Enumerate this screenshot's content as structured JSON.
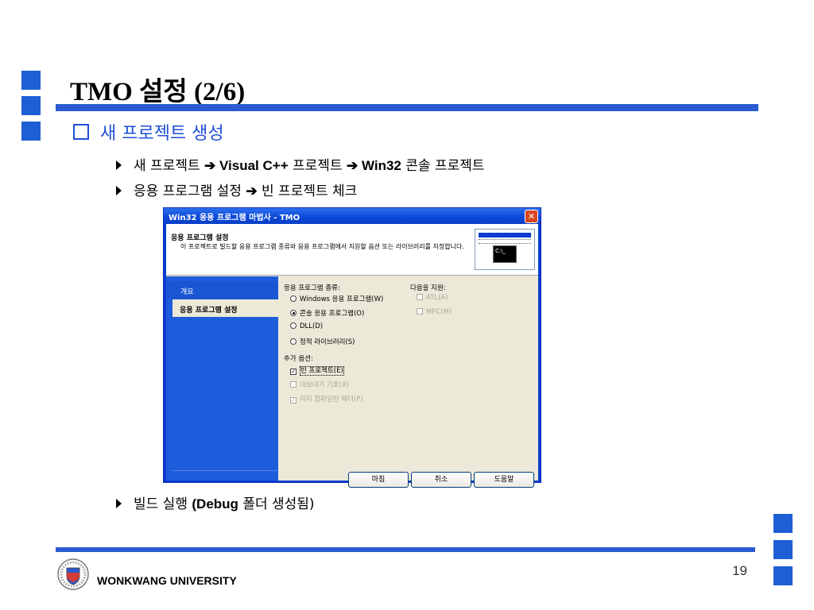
{
  "slide": {
    "title": "TMO 설정 (2/6)",
    "heading": "새 프로젝트 생성",
    "bullets": [
      {
        "prefix": "새 프로젝트 ",
        "arrow1": "➔",
        "bold1": " Visual C++",
        "mid": " 프로젝트 ",
        "arrow2": "➔",
        "bold2": " Win32",
        "suffix": " 콘솔 프로젝트"
      },
      {
        "prefix": "응용 프로그램 설정 ",
        "arrow1": "➔",
        "suffix": " 빈 프로젝트 체크"
      },
      {
        "prefix": "빌드 실행 ",
        "bold1": "(Debug",
        "suffix": " 폴더 생성됨)"
      }
    ],
    "footer": "WONKWANG UNIVERSITY",
    "page_number": "19",
    "colors": {
      "accent": "#1f5fd6",
      "rule": "#2a5bd0",
      "heading": "#1f4fd6"
    }
  },
  "dialog": {
    "title": "Win32 응용 프로그램 마법사 - TMO",
    "header_title": "응용 프로그램 설정",
    "header_desc": "이 프로젝트로 빌드할 응용 프로그램 종류와 응용 프로그램에서 지원할 옵션 또는 라이브러리를 지정합니다.",
    "icon_text": "C:\\_",
    "nav": [
      "개요",
      "응용 프로그램 설정"
    ],
    "app_type_label": "응용 프로그램 종류:",
    "app_types": [
      "Windows 응용 프로그램(W)",
      "콘솔 응용 프로그램(O)",
      "DLL(D)",
      "정적 라이브러리(S)"
    ],
    "support_label": "다음을 지원:",
    "support_options": [
      "ATL(A)",
      "MFC(M)"
    ],
    "extra_label": "추가 옵션:",
    "extra_options": [
      "빈 프로젝트(E)",
      "내보내기 기호(X)",
      "미리 컴파일된 헤더(P)"
    ],
    "buttons": [
      "마침",
      "취소",
      "도움말"
    ]
  }
}
